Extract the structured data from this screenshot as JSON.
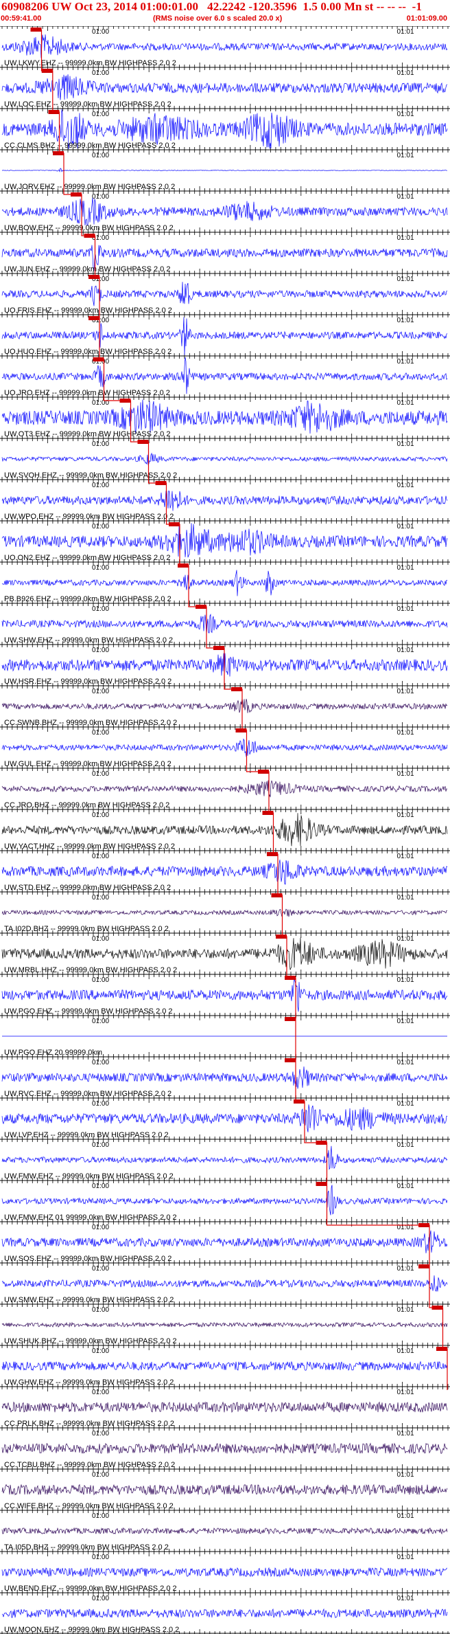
{
  "header": {
    "title": "60908206 UW Oct 23, 2014 01:00:01.00   42.2242 -120.3596  1.5 0.00 Mn st -- -- --  -1",
    "subtitle": "(RMS noise over 6.0 s scaled 20.0 x)",
    "time_start": "00:59:41.00",
    "time_end": "01:01:09.00"
  },
  "chart_data": {
    "type": "seismogram",
    "time_window": [
      "00:59:41.00",
      "01:01:09.00"
    ],
    "tick_labels": [
      "01:00",
      "01:01"
    ],
    "colors": {
      "trace": "#0000ff",
      "trace_alt": "#000000",
      "trace_dark": "#2a0055",
      "pick": "#e00000",
      "box": "#cc0000"
    },
    "traces": [
      {
        "label": "UW.LKWY.EHZ -- 99999.0km BW  HIGHPASS  2.0  2",
        "color": "#0000ff",
        "pick": 0.07,
        "amp": 0.25,
        "burst": [
          [
            0.09,
            0.05,
            2.5
          ]
        ]
      },
      {
        "label": "UW.LOC.EHZ -- 99999.0km BW  HIGHPASS  2.0  2",
        "color": "#0000ff",
        "pick": 0.095,
        "amp": 0.35,
        "burst": [
          [
            0.14,
            0.05,
            1.8
          ]
        ]
      },
      {
        "label": "CC.CLMS.BHZ -- 99999.0km BW  HIGHPASS  2.0  2",
        "color": "#0000ff",
        "pick": 0.11,
        "amp": 0.45,
        "burst": [
          [
            0.15,
            0.03,
            3
          ],
          [
            0.35,
            0.08,
            1.5
          ],
          [
            0.6,
            0.05,
            2.2
          ]
        ]
      },
      {
        "label": "UW.JORV.EHZ -- 99999.0km BW  HIGHPASS  2.0  2",
        "color": "#0000ff",
        "pick": 0.12,
        "amp": 0.02,
        "burst": [
          [
            0.13,
            0.005,
            8
          ]
        ]
      },
      {
        "label": "UW.BOW.EHZ -- 99999.0km BW  HIGHPASS  2.0  2",
        "color": "#0000ff",
        "pick": 0.16,
        "amp": 0.3,
        "burst": [
          [
            0.19,
            0.04,
            2.5
          ],
          [
            0.55,
            0.05,
            1.5
          ]
        ]
      },
      {
        "label": "UW.JUN.EHZ -- 99999.0km BW  HIGHPASS  2.0  2",
        "color": "#0000ff",
        "pick": 0.19,
        "amp": 0.3,
        "burst": [
          [
            0.21,
            0.01,
            4
          ]
        ]
      },
      {
        "label": "UO.FRIS.EHZ -- 99999.0km BW  HIGHPASS  2.0  2",
        "color": "#0000ff",
        "pick": 0.2,
        "amp": 0.25,
        "burst": [
          [
            0.41,
            0.01,
            5
          ],
          [
            0.21,
            0.01,
            3
          ]
        ]
      },
      {
        "label": "UO.HUO.EHZ -- 99999.0km BW  HIGHPASS  2.0  2",
        "color": "#0000ff",
        "pick": 0.2,
        "amp": 0.25,
        "burst": [
          [
            0.41,
            0.008,
            6
          ],
          [
            0.22,
            0.008,
            3
          ]
        ]
      },
      {
        "label": "UO.JRO.EHZ -- 99999.0km BW  HIGHPASS  2.0  2",
        "color": "#0000ff",
        "pick": 0.21,
        "amp": 0.25,
        "burst": [
          [
            0.41,
            0.01,
            5
          ],
          [
            0.22,
            0.01,
            3
          ]
        ]
      },
      {
        "label": "UW.OT3.EHZ -- 99999.0km BW  HIGHPASS  2.0  2",
        "color": "#0000ff",
        "pick": 0.27,
        "amp": 0.5,
        "burst": [
          [
            0.32,
            0.05,
            1.6
          ],
          [
            0.7,
            0.05,
            1.5
          ]
        ]
      },
      {
        "label": "UW.SVOH.EHZ -- 99999.0km BW  HIGHPASS  2.0  2",
        "color": "#0000ff",
        "pick": 0.31,
        "amp": 0.15,
        "burst": [
          [
            0.33,
            0.02,
            2
          ]
        ]
      },
      {
        "label": "UW.WPO.EHZ -- 99999.0km BW  HIGHPASS  2.0  2",
        "color": "#0000ff",
        "pick": 0.35,
        "amp": 0.3,
        "burst": [
          [
            0.38,
            0.02,
            3
          ]
        ]
      },
      {
        "label": "UO.ON2.EHZ -- 99999.0km BW  HIGHPASS  2.0  2",
        "color": "#0000ff",
        "pick": 0.38,
        "amp": 0.4,
        "burst": [
          [
            0.42,
            0.05,
            2.2
          ],
          [
            0.55,
            0.05,
            1.5
          ]
        ]
      },
      {
        "label": "PB.B926.EHZ -- 99999.0km BW  HIGHPASS  2.0  2",
        "color": "#0000ff",
        "pick": 0.4,
        "amp": 0.2,
        "burst": [
          [
            0.41,
            0.01,
            4
          ],
          [
            0.53,
            0.01,
            4
          ],
          [
            0.6,
            0.01,
            4
          ]
        ]
      },
      {
        "label": "UW.SHW.EHZ -- 99999.0km BW  HIGHPASS  2.0  2",
        "color": "#0000ff",
        "pick": 0.44,
        "amp": 0.25,
        "burst": [
          [
            0.46,
            0.02,
            2
          ]
        ]
      },
      {
        "label": "UW.HSR.EHZ -- 99999.0km BW  HIGHPASS  2.0  2",
        "color": "#0000ff",
        "pick": 0.48,
        "amp": 0.4,
        "burst": [
          [
            0.5,
            0.02,
            1.5
          ]
        ]
      },
      {
        "label": "CC.SWNB.BHZ -- 99999.0km BW  HIGHPASS  2.0  2",
        "color": "#2a0055",
        "pick": 0.52,
        "amp": 0.2,
        "burst": [
          [
            0.54,
            0.02,
            2
          ]
        ]
      },
      {
        "label": "UW.GUL.EHZ -- 99999.0km BW  HIGHPASS  2.0  2",
        "color": "#0000ff",
        "pick": 0.53,
        "amp": 0.2,
        "burst": [
          [
            0.55,
            0.02,
            3
          ]
        ]
      },
      {
        "label": "CC.JRO.BHZ -- 99999.0km BW  HIGHPASS  2.0  2",
        "color": "#2a0055",
        "pick": 0.58,
        "amp": 0.2,
        "burst": [
          [
            0.6,
            0.05,
            2
          ]
        ]
      },
      {
        "label": "UW.YACT.HHZ -- 99999.0km BW  HIGHPASS  2.0  2",
        "color": "#000000",
        "pick": 0.59,
        "amp": 0.3,
        "burst": [
          [
            0.66,
            0.04,
            3
          ]
        ]
      },
      {
        "label": "UW.STD.EHZ -- 99999.0km BW  HIGHPASS  2.0  2",
        "color": "#0000ff",
        "pick": 0.6,
        "amp": 0.35,
        "burst": [
          [
            0.63,
            0.03,
            2
          ]
        ]
      },
      {
        "label": "TA.I02D.BHZ -- 99999.0km BW  HIGHPASS  2.0  2",
        "color": "#2a0055",
        "pick": 0.61,
        "amp": 0.15,
        "burst": [
          [
            0.63,
            0.02,
            1.5
          ]
        ]
      },
      {
        "label": "UW.MRBL.HHZ -- 99999.0km BW  HIGHPASS  2.0  2",
        "color": "#000000",
        "pick": 0.62,
        "amp": 0.35,
        "burst": [
          [
            0.66,
            0.04,
            2.5
          ],
          [
            0.85,
            0.05,
            2
          ]
        ]
      },
      {
        "label": "UW.PGO.EHZ -- 99999.0km BW  HIGHPASS  2.0  2",
        "color": "#0000ff",
        "pick": 0.64,
        "amp": 0.35,
        "burst": [
          [
            0.66,
            0.01,
            4
          ]
        ]
      },
      {
        "label": "UW.PGO.EHZ 20.99999.0km",
        "color": "#0000ff",
        "pick": 0.64,
        "amp": 0.0,
        "burst": []
      },
      {
        "label": "UW.RVC.EHZ -- 99999.0km BW  HIGHPASS  2.0  2",
        "color": "#0000ff",
        "pick": 0.64,
        "amp": 0.3,
        "burst": [
          [
            0.67,
            0.02,
            2
          ]
        ]
      },
      {
        "label": "UW.LVP.EHZ -- 99999.0km BW  HIGHPASS  2.0  2",
        "color": "#0000ff",
        "pick": 0.66,
        "amp": 0.35,
        "burst": [
          [
            0.69,
            0.02,
            3
          ],
          [
            0.8,
            0.05,
            1.5
          ]
        ]
      },
      {
        "label": "UW.FMW.EHZ -- 99999.0km BW  HIGHPASS  2.0  2",
        "color": "#0000ff",
        "pick": 0.71,
        "amp": 0.2,
        "burst": [
          [
            0.74,
            0.01,
            5
          ]
        ]
      },
      {
        "label": "UW.FMW.EHZ 01 99999.0km BW  HIGHPASS  2.0  2",
        "color": "#0000ff",
        "pick": 0.71,
        "amp": 0.2,
        "burst": [
          [
            0.74,
            0.01,
            5
          ]
        ]
      },
      {
        "label": "UW.SOS.EHZ -- 99999.0km BW  HIGHPASS  2.0  2",
        "color": "#0000ff",
        "pick": 0.94,
        "amp": 0.3,
        "burst": [
          [
            0.96,
            0.02,
            2
          ]
        ]
      },
      {
        "label": "UW.SMW.EHZ -- 99999.0km BW  HIGHPASS  2.0  2",
        "color": "#0000ff",
        "pick": 0.94,
        "amp": 0.25,
        "burst": [
          [
            0.97,
            0.01,
            2.5
          ]
        ]
      },
      {
        "label": "UW.SHUK.BHZ -- 99999.0km BW  HIGHPASS  2.0  2",
        "color": "#2a0055",
        "pick": 0.97,
        "amp": 0.15,
        "burst": []
      },
      {
        "label": "UW.GHW.EHZ -- 99999.0km BW  HIGHPASS  2.0  2",
        "color": "#0000ff",
        "pick": 0.98,
        "amp": 0.3,
        "burst": []
      },
      {
        "label": "CC.PRLK.BHZ -- 99999.0km BW  HIGHPASS  2.0  2",
        "color": "#2a0055",
        "pick": null,
        "amp": 0.35,
        "burst": []
      },
      {
        "label": "CC.TCBU.BHZ -- 99999.0km BW  HIGHPASS  2.0  2",
        "color": "#2a0055",
        "pick": null,
        "amp": 0.35,
        "burst": []
      },
      {
        "label": "CC.WIFE.BHZ -- 99999.0km BW  HIGHPASS  2.0  2",
        "color": "#2a0055",
        "pick": null,
        "amp": 0.35,
        "burst": []
      },
      {
        "label": "TA.I05D.BHZ -- 99999.0km BW  HIGHPASS  2.0  2",
        "color": "#2a0055",
        "pick": null,
        "amp": 0.2,
        "burst": []
      },
      {
        "label": "UW.BEND.EHZ -- 99999.0km BW  HIGHPASS  2.0  2",
        "color": "#0000ff",
        "pick": null,
        "amp": 0.3,
        "burst": []
      },
      {
        "label": "UW.MOON.EHZ -- 99999.0km BW  HIGHPASS  2.0  2",
        "color": "#0000ff",
        "pick": null,
        "amp": 0.3,
        "burst": []
      }
    ]
  }
}
